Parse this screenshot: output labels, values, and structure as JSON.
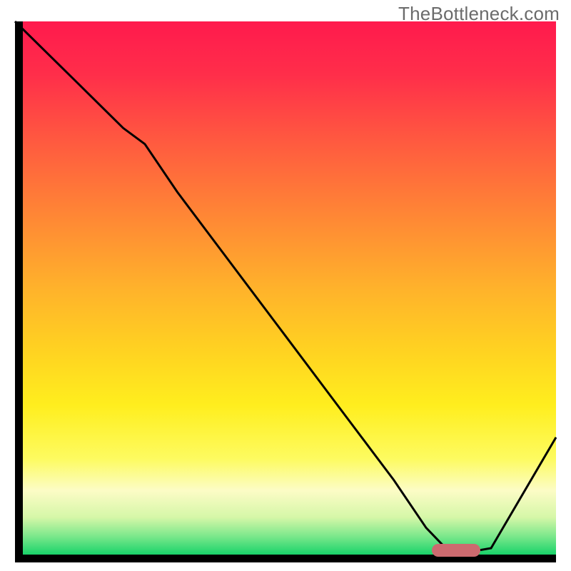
{
  "watermark": "TheBottleneck.com",
  "colors": {
    "gradient_stops": [
      {
        "offset": 0.0,
        "color": "#ff1a4d"
      },
      {
        "offset": 0.1,
        "color": "#ff2e4a"
      },
      {
        "offset": 0.22,
        "color": "#ff5840"
      },
      {
        "offset": 0.35,
        "color": "#ff8236"
      },
      {
        "offset": 0.5,
        "color": "#ffb22b"
      },
      {
        "offset": 0.62,
        "color": "#ffd321"
      },
      {
        "offset": 0.72,
        "color": "#ffee1e"
      },
      {
        "offset": 0.82,
        "color": "#fdfb60"
      },
      {
        "offset": 0.88,
        "color": "#fcfcc6"
      },
      {
        "offset": 0.93,
        "color": "#d6f7a8"
      },
      {
        "offset": 0.965,
        "color": "#7de88c"
      },
      {
        "offset": 1.0,
        "color": "#19d36a"
      }
    ],
    "frame": "#000000",
    "curve": "#000000",
    "marker": "#cc6a6f"
  },
  "chart_data": {
    "type": "line",
    "title": "",
    "xlabel": "",
    "ylabel": "",
    "xlim": [
      0,
      100
    ],
    "ylim": [
      0,
      100
    ],
    "grid": false,
    "series": [
      {
        "name": "bottleneck-curve",
        "x": [
          0,
          6,
          12,
          20,
          24,
          30,
          40,
          50,
          60,
          70,
          76,
          80,
          84,
          88,
          100
        ],
        "y": [
          100,
          94,
          88,
          80,
          77,
          68,
          54.5,
          41,
          27.5,
          14,
          5,
          0.8,
          0.5,
          1.2,
          22
        ]
      }
    ],
    "annotations": [
      {
        "name": "optimal-marker",
        "x_range": [
          77,
          86
        ],
        "y": 0.8
      }
    ]
  }
}
